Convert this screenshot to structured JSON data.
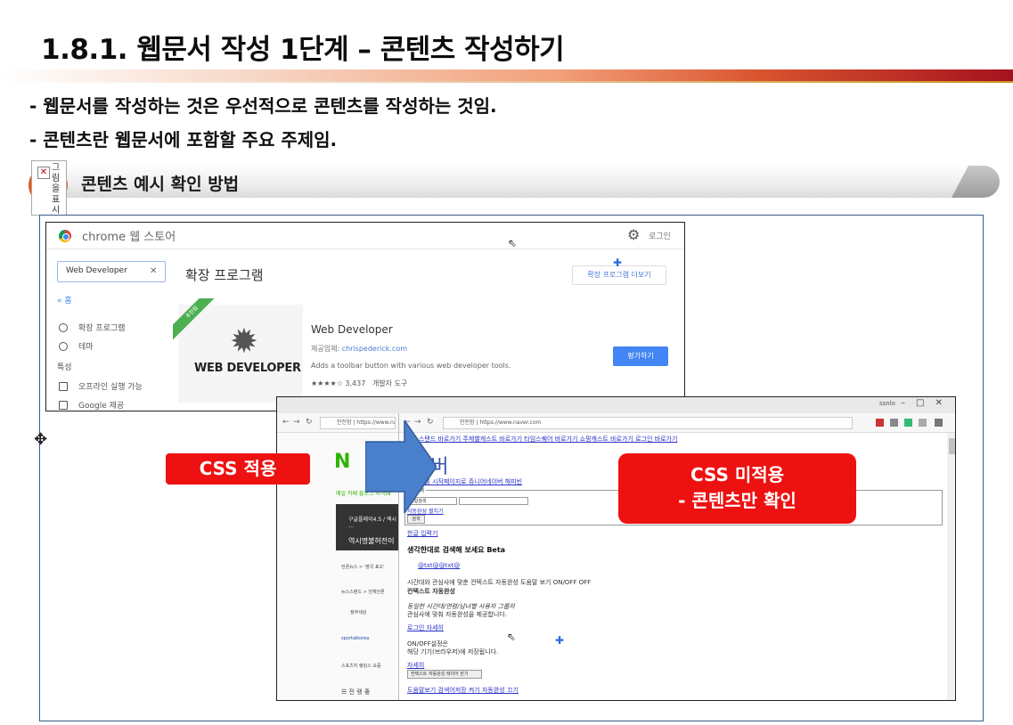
{
  "slide": {
    "title": "1.8.1. 웹문서 작성 1단계 – 콘텐츠 작성하기",
    "bullets": [
      "- 웹문서를 작성하는 것은 우선적으로 콘텐츠를 작성하는 것임.",
      "- 콘텐츠란 웹문서에 포함할 주요 주제임."
    ],
    "section_banner": "콘텐츠 예시 확인 방법",
    "broken_image_text": "그림을 표시"
  },
  "chrome_store": {
    "name": "chrome 웹 스토어",
    "login": "로그인",
    "search_value": "Web Developer",
    "home_link": "« 홈",
    "filters": [
      "확장 프로그램",
      "테마"
    ],
    "features_label": "특성",
    "checkboxes": [
      "오프라인 실행 가능",
      "Google 제공"
    ],
    "heading": "확장 프로그램",
    "more_button": "확장 프로그램 더보기",
    "ribbon": "추천됨",
    "card_logo": "WEB DEVELOPER",
    "extension": {
      "name": "Web Developer",
      "provider_label": "제공업체:",
      "provider": "chrispederick.com",
      "description": "Adds a toolbar button with various web developer tools.",
      "rating": "★★★★☆ 3,437",
      "category": "개발자 도구",
      "button": "평가하기"
    }
  },
  "browser": {
    "user": "ssnlo",
    "url_left": "안전함 | https://www.naver...",
    "url_right": "안전함 | https://www.naver.com",
    "left_menu": "메일 카페 블로그 지식iN",
    "banner_text": "구글플레이4.5 / 엑시 …",
    "banner_sub": "역시명불허전이",
    "left_items": [
      "언론뉴스 > '영국 표오'",
      "뉴스스탠드 > 전체언론",
      "정부세상",
      "sportalkorea",
      "스포츠지 랭킹스 요즘"
    ],
    "top_links": "뉴스스탠드 바로가기 주제별캐스트 바로가기 타임스퀘어 바로가기 쇼핑캐스트 바로가기 로그인 바로가기",
    "logo_partial": "N",
    "logo_partial_2": "이버",
    "start_link": "네이버를 시작페이지로  쥬니어네이버  해피빈",
    "search_legend": "검색",
    "search_select": "통합검색",
    "auto_complete_link": "자동완성 펼치기",
    "search_button": "검색",
    "hangul_input": "한글 입력기",
    "think_title": "생각한대로 검색해 보세요 Beta",
    "think_item": "@txt@@txt@",
    "think_desc": "시간대와 관심사에 맞춘 컨텍스트 자동완성  도움말 보기  ON/OFF  OFF",
    "context_title": "컨텍스트 자동완성",
    "context_desc_1": "동일한 시간대/연령/남녀별 사용자 그룹의",
    "context_desc_2": "관심사에 맞춰 자동완성을 제공합니다.",
    "login_link": "로그인  자세히",
    "onoff_1": "ON/OFF설정은",
    "onoff_2": "해당 기기(브라우저)에 저장됩니다.",
    "detail_link": "자세히",
    "context_button": "컨텍스트 자동완성 레이어 닫기",
    "bottom_link": "도움말보기 검색어저장 켜기  자동완성 끄기"
  },
  "callouts": {
    "css_applied": "CSS 적용",
    "css_not_applied_line1": "CSS 미적용",
    "css_not_applied_line2": "- 콘텐츠만 확인"
  },
  "colors": {
    "callout_red": "#ee1111",
    "arrow_blue": "#4a7fcb",
    "banner_circle": "#e8561f",
    "naver_green": "#2db400"
  }
}
